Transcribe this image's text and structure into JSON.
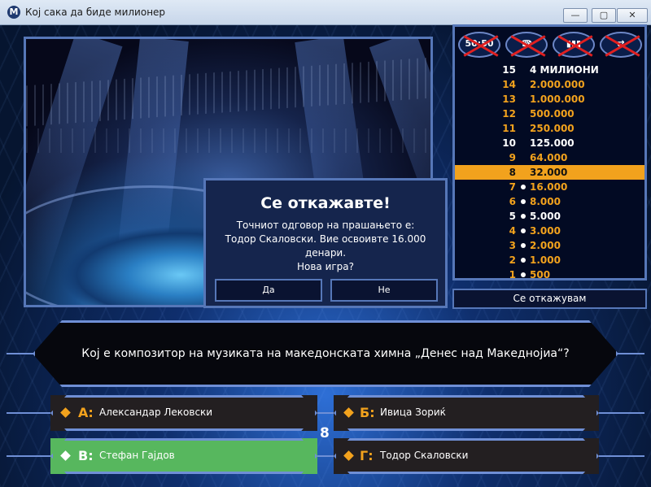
{
  "window": {
    "app_icon": "M",
    "title": "Кој сака да биде милионер",
    "minimize_glyph": "—",
    "maximize_glyph": "▢",
    "close_glyph": "✕"
  },
  "lifelines": [
    {
      "name": "fifty-fifty",
      "glyph": "50:50",
      "used": true
    },
    {
      "name": "phone-a-friend",
      "glyph": "☎",
      "used": true
    },
    {
      "name": "ask-the-audience",
      "glyph": "▮▮▮",
      "used": true
    },
    {
      "name": "switch-question",
      "glyph": "⇄",
      "used": true
    }
  ],
  "money_ladder": [
    {
      "level": "15",
      "amount": "4 МИЛИОНИ",
      "milestone": true,
      "dot": false,
      "current": false
    },
    {
      "level": "14",
      "amount": "2.000.000",
      "milestone": false,
      "dot": false,
      "current": false
    },
    {
      "level": "13",
      "amount": "1.000.000",
      "milestone": false,
      "dot": false,
      "current": false
    },
    {
      "level": "12",
      "amount": "500.000",
      "milestone": false,
      "dot": false,
      "current": false
    },
    {
      "level": "11",
      "amount": "250.000",
      "milestone": false,
      "dot": false,
      "current": false
    },
    {
      "level": "10",
      "amount": "125.000",
      "milestone": true,
      "dot": false,
      "current": false
    },
    {
      "level": "9",
      "amount": "64.000",
      "milestone": false,
      "dot": false,
      "current": false
    },
    {
      "level": "8",
      "amount": "32.000",
      "milestone": false,
      "dot": false,
      "current": true
    },
    {
      "level": "7",
      "amount": "16.000",
      "milestone": false,
      "dot": true,
      "current": false
    },
    {
      "level": "6",
      "amount": "8.000",
      "milestone": false,
      "dot": true,
      "current": false
    },
    {
      "level": "5",
      "amount": "5.000",
      "milestone": true,
      "dot": true,
      "current": false
    },
    {
      "level": "4",
      "amount": "3.000",
      "milestone": false,
      "dot": true,
      "current": false
    },
    {
      "level": "3",
      "amount": "2.000",
      "milestone": false,
      "dot": true,
      "current": false
    },
    {
      "level": "2",
      "amount": "1.000",
      "milestone": false,
      "dot": true,
      "current": false
    },
    {
      "level": "1",
      "amount": "500",
      "milestone": false,
      "dot": true,
      "current": false
    }
  ],
  "quit_button": "Се откажувам",
  "question": "Кој е композитор на музиката на македонската химна „Денес над Македнојиа“?",
  "answers": {
    "a": {
      "letter": "А:",
      "text": "Александар Лековски"
    },
    "b": {
      "letter": "Б:",
      "text": "Ивица Зориќ"
    },
    "c": {
      "letter": "В:",
      "text": "Стефан Гајдов"
    },
    "d": {
      "letter": "Г:",
      "text": "Тодор Скаловски"
    }
  },
  "question_number": "8",
  "dialog": {
    "title": "Се откажавте!",
    "line1": "Точниот одговор на прашањето е:",
    "line2": "Тодор Скаловски. Вие освоивте 16.000",
    "line3": "денари.",
    "line4": "Нова игра?",
    "yes": "Да",
    "no": "Не"
  },
  "colors": {
    "accent": "#f2a21d",
    "frame": "#6f8fd6",
    "correct": "#57b75e"
  }
}
